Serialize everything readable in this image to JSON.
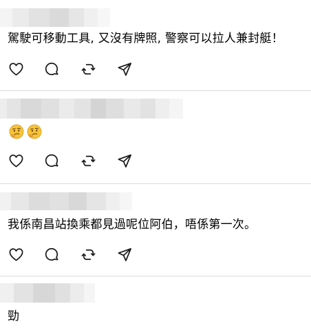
{
  "comments": [
    {
      "text": "駕駛可移動工具, 又沒有牌照, 警察可以拉人兼封艇！",
      "has_actions": true
    },
    {
      "text": "",
      "emojis": [
        "thinking-face",
        "thinking-face"
      ],
      "has_actions": true
    },
    {
      "text": "我係南昌站換乘都見過呢位阿伯，唔係第一次。",
      "has_actions": true
    },
    {
      "text": "勁",
      "has_actions": false
    }
  ],
  "action_icons": [
    "heart-icon",
    "comment-icon",
    "repost-icon",
    "share-icon"
  ],
  "colors": {
    "divider": "#dcdcdc",
    "icon": "#1a1a1a",
    "emoji": "#f6c33a"
  }
}
